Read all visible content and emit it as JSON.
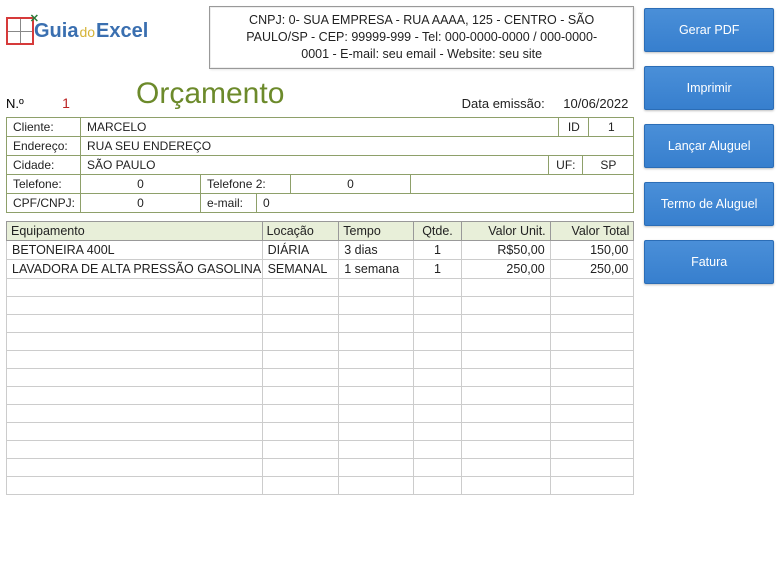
{
  "logo": {
    "guia": "Guia",
    "do": "do",
    "excel": "Excel"
  },
  "company": {
    "line1": "CNPJ: 0- SUA EMPRESA - RUA AAAA, 125 - CENTRO - SÃO",
    "line2": "PAULO/SP - CEP: 99999-999 - Tel: 000-0000-0000 / 000-0000-",
    "line3": "0001 - E-mail: seu email - Website: seu site"
  },
  "buttons": {
    "pdf": "Gerar PDF",
    "print": "Imprimir",
    "aluguel": "Lançar Aluguel",
    "termo": "Termo de Aluguel",
    "fatura": "Fatura"
  },
  "doc": {
    "num_label": "N.º",
    "num": "1",
    "title": "Orçamento",
    "emissao_label": "Data emissão:",
    "emissao": "10/06/2022"
  },
  "form": {
    "cliente_label": "Cliente:",
    "cliente": "MARCELO",
    "id_label": "ID",
    "id": "1",
    "endereco_label": "Endereço:",
    "endereco": "RUA SEU ENDEREÇO",
    "cidade_label": "Cidade:",
    "cidade": "SÃO PAULO",
    "uf_label": "UF:",
    "uf": "SP",
    "tel_label": "Telefone:",
    "tel": "0",
    "tel2_label": "Telefone 2:",
    "tel2": "0",
    "cpf_label": "CPF/CNPJ:",
    "cpf": "0",
    "email_label": "e-mail:",
    "email": "0"
  },
  "table": {
    "headers": {
      "equip": "Equipamento",
      "loc": "Locação",
      "tempo": "Tempo",
      "qtde": "Qtde.",
      "vu": "Valor Unit.",
      "vt": "Valor Total"
    },
    "rows": [
      {
        "equip": "BETONEIRA 400L",
        "loc": "DIÁRIA",
        "tempo": "3 dias",
        "qtde": "1",
        "vu": "R$50,00",
        "vt": "150,00"
      },
      {
        "equip": "LAVADORA DE ALTA PRESSÃO GASOLINA",
        "loc": "SEMANAL",
        "tempo": "1 semana",
        "qtde": "1",
        "vu": "250,00",
        "vt": "250,00"
      }
    ],
    "blank_rows": 12
  }
}
